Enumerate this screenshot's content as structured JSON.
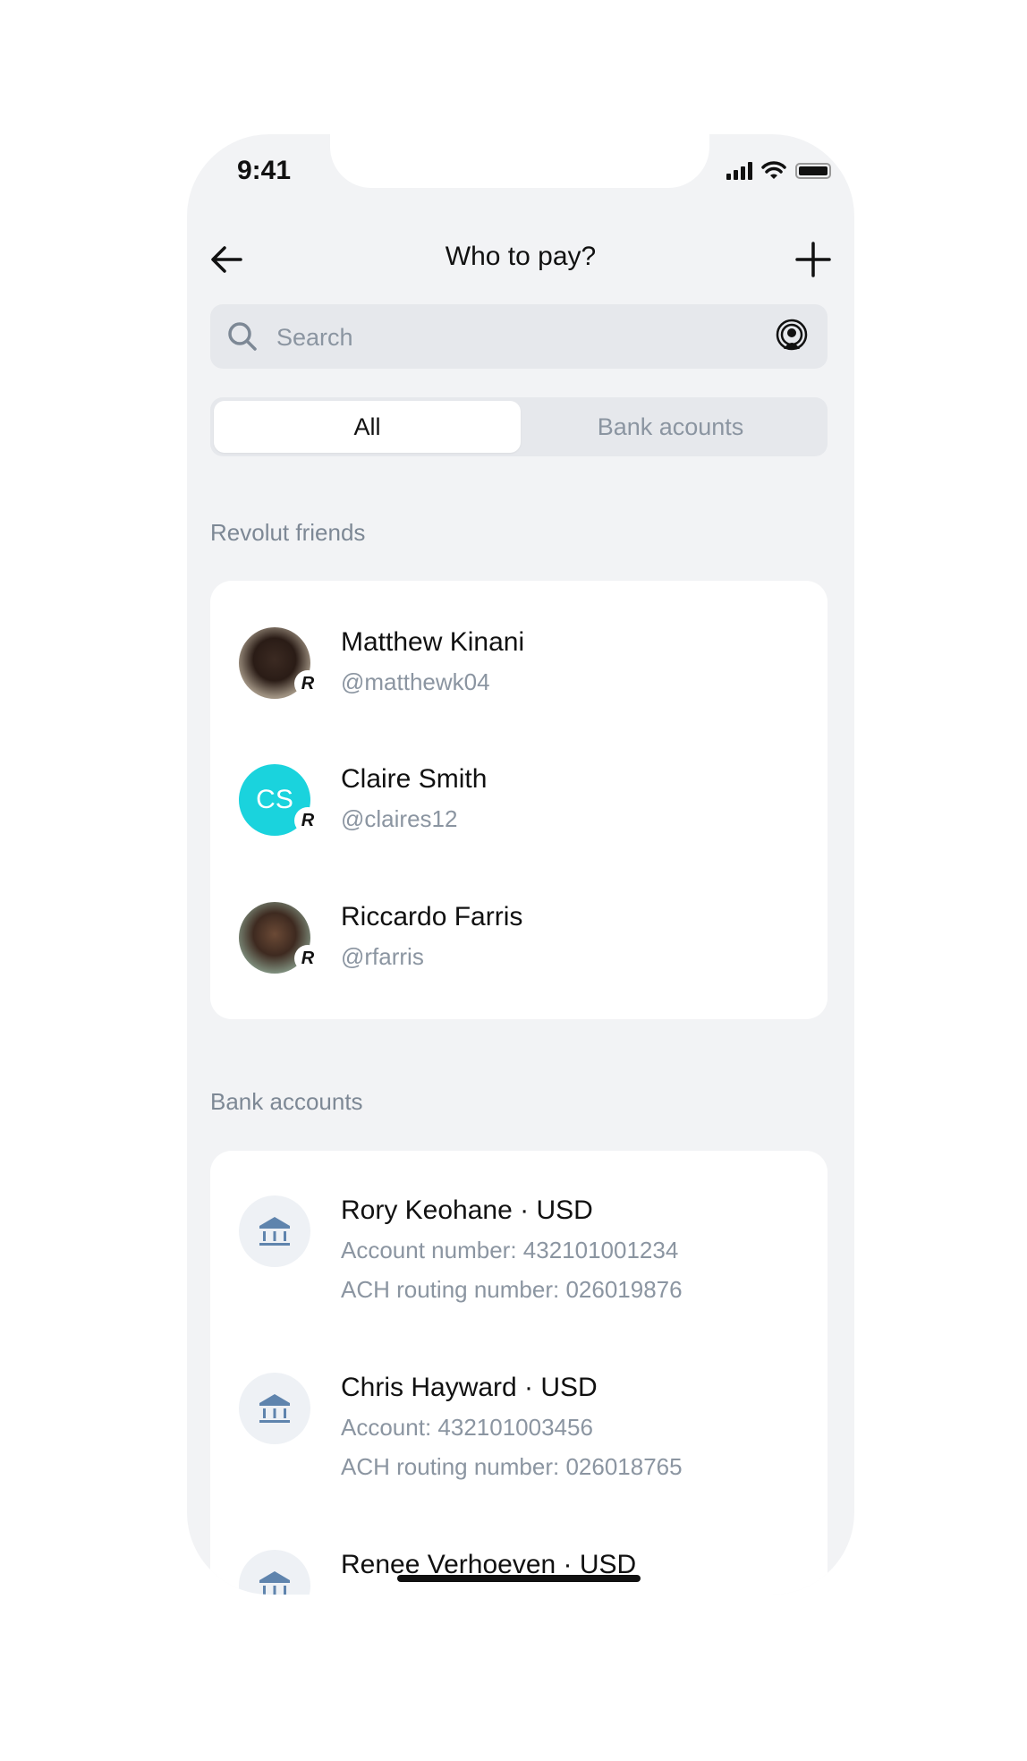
{
  "status_bar": {
    "time": "9:41"
  },
  "header": {
    "title": "Who to pay?",
    "back_icon": "arrow-left-icon",
    "add_icon": "plus-icon"
  },
  "search": {
    "placeholder": "Search",
    "value": "",
    "search_icon": "search-icon",
    "nearby_icon": "nearby-person-icon"
  },
  "tabs": [
    {
      "label": "All",
      "active": true
    },
    {
      "label": "Bank acounts",
      "active": false
    }
  ],
  "friends_section": {
    "label": "Revolut friends",
    "items": [
      {
        "name": "Matthew Kinani",
        "handle": "@matthewk04",
        "avatar": "photo",
        "badge": "R"
      },
      {
        "name": "Claire Smith",
        "handle": "@claires12",
        "avatar": "initials",
        "initials": "CS",
        "avatar_color": "#1ad3dd",
        "badge": "R"
      },
      {
        "name": "Riccardo Farris",
        "handle": "@rfarris",
        "avatar": "photo",
        "badge": "R"
      }
    ]
  },
  "bank_section": {
    "label": "Bank accounts",
    "items": [
      {
        "title": "Rory Keohane · USD",
        "line1": "Account number: 432101001234",
        "line2": "ACH routing number: 026019876"
      },
      {
        "title": "Chris Hayward · USD",
        "line1": "Account: 432101003456",
        "line2": "ACH routing number: 026018765"
      },
      {
        "title": "Renee Verhoeven · USD"
      }
    ]
  },
  "colors": {
    "background": "#f2f3f5",
    "accent_teal": "#1ad3dd",
    "bank_icon": "#5f84ad",
    "secondary_text": "#8b95a1"
  }
}
